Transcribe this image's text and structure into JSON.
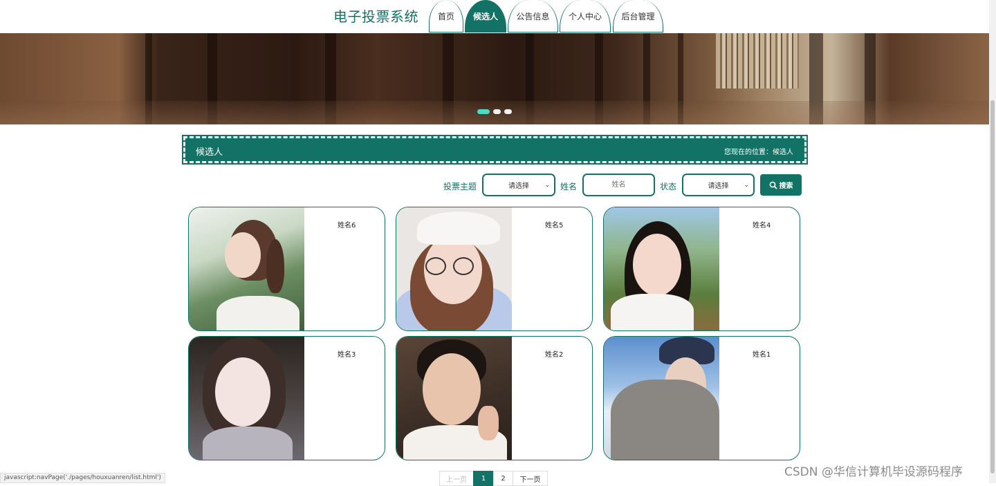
{
  "site": {
    "title": "电子投票系统"
  },
  "nav": {
    "items": [
      {
        "label": "首页"
      },
      {
        "label": "候选人"
      },
      {
        "label": "公告信息"
      },
      {
        "label": "个人中心"
      },
      {
        "label": "后台管理"
      }
    ],
    "active_index": 1
  },
  "banner": {
    "slides": 3,
    "active_slide": 0
  },
  "section": {
    "title": "候选人",
    "breadcrumb": "您现在的位置：候选人"
  },
  "search": {
    "theme_label": "投票主题",
    "theme_value": "请选择",
    "name_label": "姓名",
    "name_placeholder": "姓名",
    "status_label": "状态",
    "status_value": "请选择",
    "button_label": "搜索"
  },
  "candidates": [
    {
      "name": "姓名6"
    },
    {
      "name": "姓名5"
    },
    {
      "name": "姓名4"
    },
    {
      "name": "姓名3"
    },
    {
      "name": "姓名2"
    },
    {
      "name": "姓名1"
    }
  ],
  "pagination": {
    "prev": "上一页",
    "pages": [
      "1",
      "2"
    ],
    "current": "1",
    "next": "下一页"
  },
  "statusbar": {
    "text": "javascript:navPage('./pages/houxuanren/list.html')"
  },
  "watermark": {
    "text": "CSDN @华信计算机毕设源码程序"
  },
  "colors": {
    "primary": "#137266",
    "accent_dot": "#48dcc5"
  }
}
